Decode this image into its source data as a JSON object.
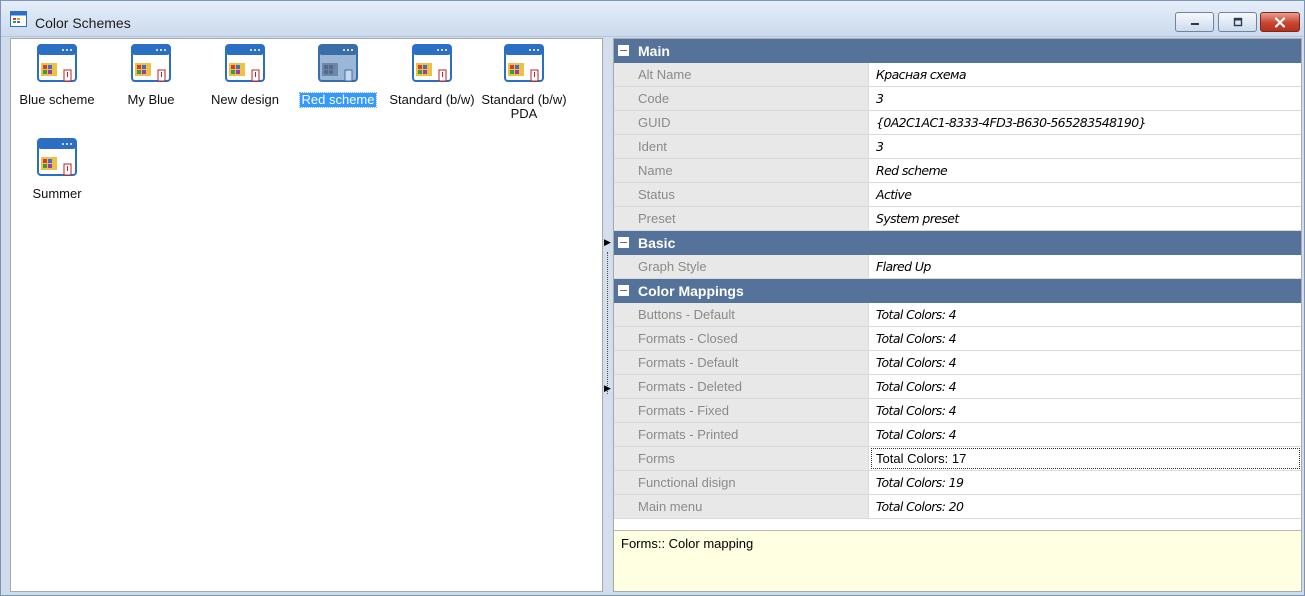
{
  "window": {
    "title": "Color Schemes"
  },
  "schemes": [
    {
      "label": "Blue scheme"
    },
    {
      "label": "My Blue"
    },
    {
      "label": "New design"
    },
    {
      "label": "Red scheme",
      "selected": true
    },
    {
      "label": "Standard (b/w)"
    },
    {
      "label": "Standard (b/w) PDA"
    },
    {
      "label": "Summer"
    }
  ],
  "properties": {
    "main": {
      "header": "Main",
      "rows": [
        {
          "name": "Alt Name",
          "value": "Красная схема"
        },
        {
          "name": "Code",
          "value": "3"
        },
        {
          "name": "GUID",
          "value": "{0A2C1AC1-8333-4FD3-B630-565283548190}"
        },
        {
          "name": "Ident",
          "value": "3"
        },
        {
          "name": "Name",
          "value": "Red scheme"
        },
        {
          "name": "Status",
          "value": "Active"
        },
        {
          "name": "Preset",
          "value": "System preset"
        }
      ]
    },
    "basic": {
      "header": "Basic",
      "rows": [
        {
          "name": "Graph Style",
          "value": "Flared Up"
        }
      ]
    },
    "color_mappings": {
      "header": "Color Mappings",
      "rows": [
        {
          "name": "Buttons - Default",
          "value": "Total Colors: 4"
        },
        {
          "name": "Formats - Closed",
          "value": "Total Colors: 4"
        },
        {
          "name": "Formats - Default",
          "value": "Total Colors: 4"
        },
        {
          "name": "Formats - Deleted",
          "value": "Total Colors: 4"
        },
        {
          "name": "Formats - Fixed",
          "value": "Total Colors: 4"
        },
        {
          "name": "Formats - Printed",
          "value": "Total Colors: 4"
        },
        {
          "name": "Forms",
          "value": "Total Colors: 17"
        },
        {
          "name": "Functional disign",
          "value": "Total Colors: 19"
        },
        {
          "name": "Main menu",
          "value": "Total Colors: 20"
        }
      ]
    }
  },
  "description": {
    "text": "Forms:: Color mapping"
  },
  "colors": {
    "category_header": "#55739a",
    "selection": "#3399ff",
    "description_bg": "#ffffe1",
    "close_button": "#c84531"
  }
}
